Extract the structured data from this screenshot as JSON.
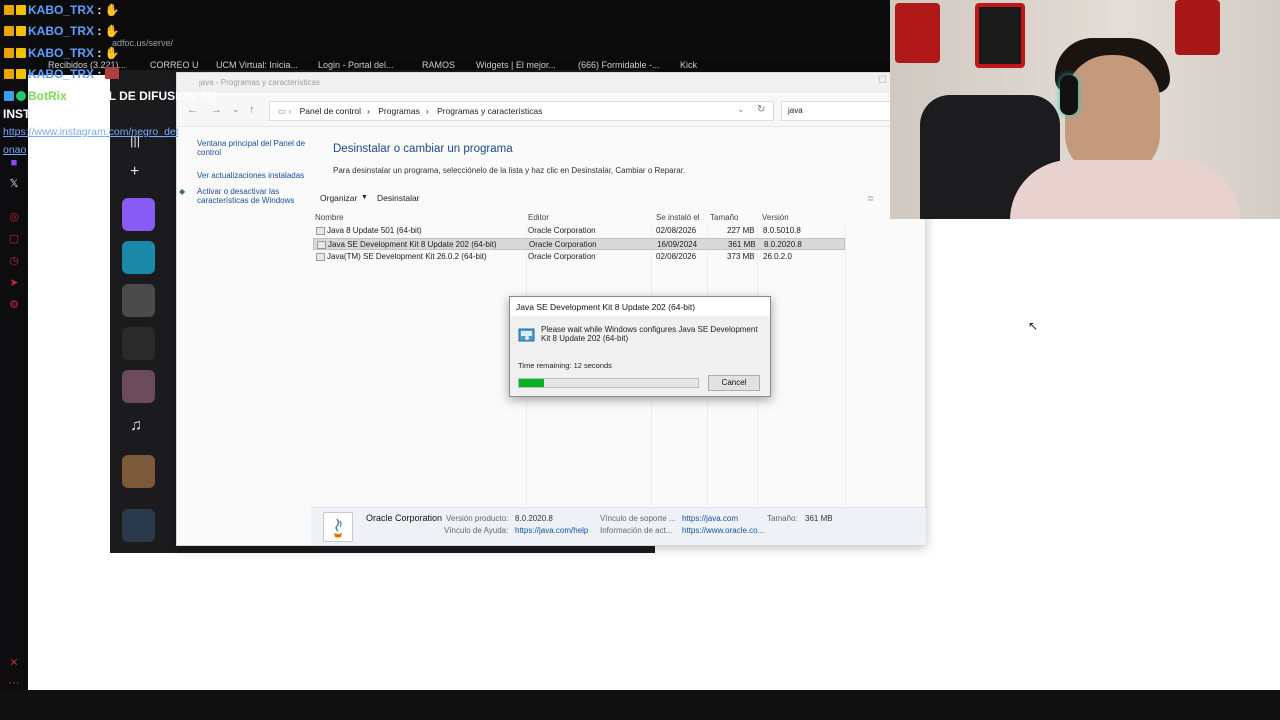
{
  "chat": {
    "lines": [
      {
        "user": "KABO_TRX",
        "msg": ":"
      },
      {
        "user": "KABO_TRX",
        "msg": ":"
      },
      {
        "user": "KABO_TRX",
        "msg": ":"
      },
      {
        "user": "KABO_TRX",
        "msg": ":"
      }
    ],
    "bot_user": "BotRix",
    "bot_msg": ": CANAL DE DIFUSION EN",
    "bot_msg2": "INSTAGRAM:",
    "bot_link1": "https://www.instagram.com/negro_det",
    "bot_link2": "onao"
  },
  "browser": {
    "address": "adfoc.us/serve/",
    "bookmarks": [
      "Recibidos (3.221)...",
      "CORREO U",
      "UCM Virtual: Inicia...",
      "Login - Portal del...",
      "RAMOS",
      "Widgets | El mejor...",
      "(666) Formidable -...",
      "Kick"
    ]
  },
  "window": {
    "title": "java - Programas y características",
    "breadcrumbs": [
      "Panel de control",
      "Programas",
      "Programas y características"
    ],
    "search_value": "java",
    "left_links": [
      "Ventana principal del Panel de control",
      "Ver actualizaciones instaladas",
      "Activar o desactivar las características de Windows"
    ],
    "heading": "Desinstalar o cambiar un programa",
    "subheading": "Para desinstalar un programa, selecciónelo de la lista y haz clic en Desinstalar, Cambiar o Reparar.",
    "organize": "Organizar",
    "uninstall": "Desinstalar",
    "columns": [
      "Nombre",
      "Editor",
      "Se instaló el",
      "Tamaño",
      "Versión"
    ],
    "programs": [
      {
        "name": "Java 8 Update 501 (64-bit)",
        "publisher": "Oracle Corporation",
        "installed": "02/08/2026",
        "size": "227 MB",
        "version": "8.0.5010.8"
      },
      {
        "name": "Java SE Development Kit 8 Update 202 (64-bit)",
        "publisher": "Oracle Corporation",
        "installed": "16/09/2024",
        "size": "361 MB",
        "version": "8.0.2020.8"
      },
      {
        "name": "Java(TM) SE Development Kit 26.0.2 (64-bit)",
        "publisher": "Oracle Corporation",
        "installed": "02/08/2026",
        "size": "373 MB",
        "version": "26.0.2.0"
      }
    ],
    "details": {
      "company": "Oracle Corporation",
      "version_label": "Versión producto:",
      "version": "8.0.2020.8",
      "support_label": "Vínculo de soporte ...",
      "support": "https://java.com",
      "size_label": "Tamaño:",
      "size": "361 MB",
      "help_label": "Vínculo de Ayuda:",
      "help": "https://java.com/help",
      "info_label": "Información de act...",
      "info": "https://www.oracle.co..."
    }
  },
  "dialog": {
    "title": "Java SE Development Kit 8 Update 202 (64-bit)",
    "message": "Please wait while Windows configures Java SE Development Kit 8 Update 202 (64-bit)",
    "time_remaining": "Time remaining: 12 seconds",
    "progress": 0.14,
    "cancel": "Cancel"
  },
  "colors": {
    "progress_fill": "#06b025",
    "link_blue": "#1a4fa0",
    "chat_user": "#5ea0ff"
  }
}
